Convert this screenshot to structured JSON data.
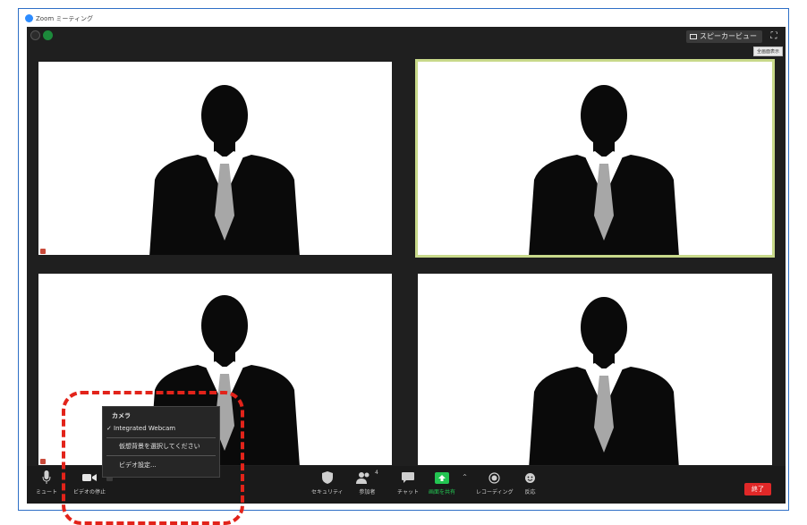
{
  "window": {
    "title": "Zoom ミーティング"
  },
  "header": {
    "speaker_view_label": "スピーカービュー",
    "tooltip": "全画面表示"
  },
  "video_menu": {
    "header": "カメラ",
    "camera_item": "Integrated Webcam",
    "camera_check": "✓",
    "virtual_bg_item": "仮想背景を選択してください",
    "settings_item": "ビデオ設定..."
  },
  "toolbar": {
    "mute_label": "ミュート",
    "stop_video_label": "ビデオの停止",
    "security_label": "セキュリティ",
    "participants_label": "参加者",
    "participants_count": "4",
    "chat_label": "チャット",
    "share_label": "画面を共有",
    "record_label": "レコーディング",
    "reactions_label": "反応",
    "end_label": "終了",
    "caret": "^"
  },
  "colors": {
    "accent": "#2d8cff",
    "share_green": "#23c552",
    "end_red": "#e02828",
    "active_speaker": "#c8d98a",
    "annotation_red": "#e2231a"
  }
}
